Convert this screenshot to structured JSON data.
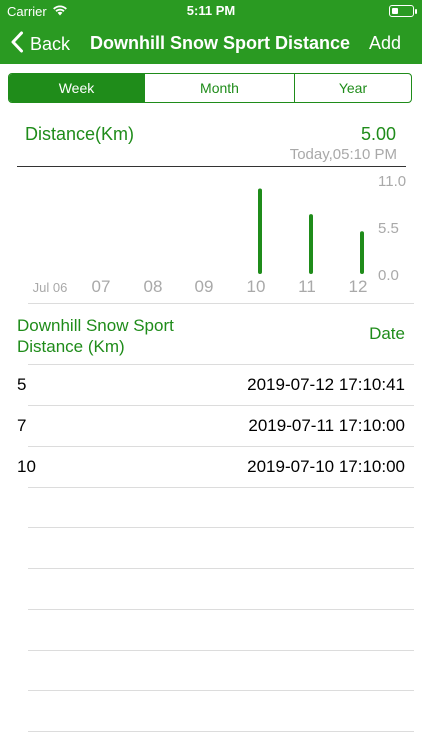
{
  "status_bar": {
    "carrier": "Carrier",
    "time": "5:11 PM"
  },
  "nav": {
    "back_label": "Back",
    "title": "Downhill Snow Sport Distance",
    "add_label": "Add",
    "color": "#2a9a22"
  },
  "tabs": [
    {
      "label": "Week",
      "active": true
    },
    {
      "label": "Month",
      "active": false
    },
    {
      "label": "Year",
      "active": false
    }
  ],
  "summary": {
    "label": "Distance(Km)",
    "value": "5.00",
    "timestamp": "Today,05:10 PM"
  },
  "chart_data": {
    "type": "bar",
    "categories": [
      "Jul 06",
      "07",
      "08",
      "09",
      "10",
      "11",
      "12"
    ],
    "values": [
      0,
      0,
      0,
      0,
      10,
      7,
      5
    ],
    "y_ticks": [
      "11.0",
      "5.5",
      "0.0"
    ],
    "ylim": [
      0,
      11
    ],
    "bar_color": "#1f8c1a",
    "grid": false
  },
  "table": {
    "header_value": "Downhill Snow Sport Distance (Km)",
    "header_value_line1": "Downhill Snow Sport",
    "header_value_line2": "Distance (Km)",
    "header_date": "Date",
    "rows": [
      {
        "value": "5",
        "date": "2019-07-12 17:10:41"
      },
      {
        "value": "7",
        "date": "2019-07-11 17:10:00"
      },
      {
        "value": "10",
        "date": "2019-07-10 17:10:00"
      }
    ]
  }
}
